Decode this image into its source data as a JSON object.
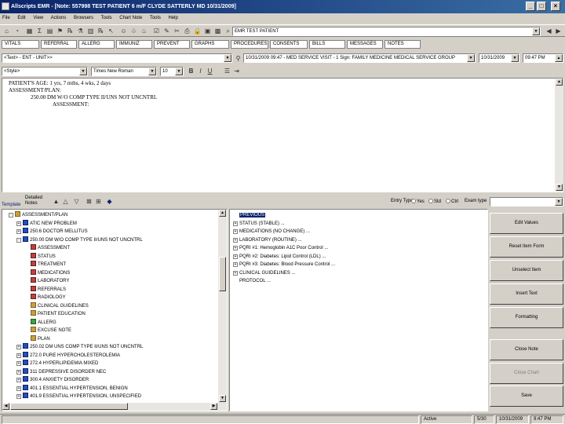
{
  "window": {
    "title": "Allscripts EMR - [Note: 557998 TEST PATIENT 6 m/F CLYDE SATTERLY MD 10/31/2009]",
    "minimize": "_",
    "maximize": "□",
    "close": "×"
  },
  "menu": [
    "File",
    "Edit",
    "View",
    "Actions",
    "Browsers",
    "Tools",
    "Chart Note",
    "Tools",
    "Help"
  ],
  "toolbar": {
    "patient_combo": "EMR TEST PATIENT"
  },
  "tabs": [
    "VITALS",
    "REFERRAL",
    "ALLERG",
    "IMMUNIZ",
    "PREVENT",
    "GRAPHS",
    "PROCEDURES",
    "CONSENTS",
    "BILLS",
    "MESSAGES",
    "NOTES"
  ],
  "note_row": {
    "template_combo": "<Text> - ENT - UNIT>>",
    "info_combo": "10/31/2009 09:47 - MED SERVICE VISIT - 1 Sign: FAMILY MEDICINE MEDICAL SERVICE GROUP",
    "date_value": "10/31/2009",
    "time_value": "09:47 PM"
  },
  "format_row": {
    "style_value": "<Style>",
    "font_value": "Times New Roman",
    "size_value": "10"
  },
  "editor": {
    "line1": "PATIENT'S AGE: 1 yrs, 7 mths, 4 wks, 2 days",
    "line2": "ASSESSMENT/PLAN:",
    "line3": "250.00 DM W/O COMP TYPE II/UNS NOT UNCNTRL",
    "line4": "ASSESSMENT:"
  },
  "lower_bar": {
    "template_label": "Template",
    "tab_label": "Detailed Notes",
    "entry_type_label": "Entry Type",
    "radio_1": "Yes",
    "radio_2": "Std",
    "radio_3": "Ctrl",
    "exam_label": "Exam type"
  },
  "tree": [
    {
      "text": "ASSESSMENT/PLAN",
      "indent": 0,
      "exp": "-",
      "icon": "folder",
      "sel": false
    },
    {
      "text": "ATIC NEW PROBLEM",
      "indent": 1,
      "exp": "+",
      "icon": "blue",
      "sel": false
    },
    {
      "text": "250.6 DOCTOR MELLITUS",
      "indent": 1,
      "exp": "+",
      "icon": "blue",
      "sel": false
    },
    {
      "text": "250.00 DM W/O COMP TYPE II/UNS NOT UNCNTRL",
      "indent": 1,
      "exp": "-",
      "icon": "blue",
      "sel": false
    },
    {
      "text": "ASSESSMENT",
      "indent": 2,
      "exp": "",
      "icon": "red",
      "sel": false
    },
    {
      "text": "STATUS",
      "indent": 2,
      "exp": "",
      "icon": "red",
      "sel": false
    },
    {
      "text": "TREATMENT",
      "indent": 2,
      "exp": "",
      "icon": "red",
      "sel": false
    },
    {
      "text": "MEDICATIONS",
      "indent": 2,
      "exp": "",
      "icon": "red",
      "sel": false
    },
    {
      "text": "LABORATORY",
      "indent": 2,
      "exp": "",
      "icon": "red",
      "sel": false
    },
    {
      "text": "REFERRALS",
      "indent": 2,
      "exp": "",
      "icon": "red",
      "sel": false
    },
    {
      "text": "RADIOLOGY",
      "indent": 2,
      "exp": "",
      "icon": "red",
      "sel": false
    },
    {
      "text": "CLINICAL GUIDELINES",
      "indent": 2,
      "exp": "",
      "icon": "folder",
      "sel": false
    },
    {
      "text": "PATIENT EDUCATION",
      "indent": 2,
      "exp": "",
      "icon": "folder",
      "sel": false
    },
    {
      "text": "ALLERG",
      "indent": 2,
      "exp": "",
      "icon": "grn",
      "sel": false
    },
    {
      "text": "EXCUSE NOTE",
      "indent": 2,
      "exp": "",
      "icon": "folder",
      "sel": false
    },
    {
      "text": "PLAN",
      "indent": 2,
      "exp": "",
      "icon": "folder",
      "sel": false
    },
    {
      "text": "250.02 DM UNS COMP TYPE II/UNS NOT UNCNTRL",
      "indent": 1,
      "exp": "+",
      "icon": "blue",
      "sel": false
    },
    {
      "text": "272.0 PURE HYPERCHOLESTEROLEMIA",
      "indent": 1,
      "exp": "+",
      "icon": "blue",
      "sel": false
    },
    {
      "text": "272.4 HYPERLIPIDEMIA MIXED",
      "indent": 1,
      "exp": "+",
      "icon": "blue",
      "sel": false
    },
    {
      "text": "311 DEPRESSIVE DISORDER NEC",
      "indent": 1,
      "exp": "+",
      "icon": "blue",
      "sel": false
    },
    {
      "text": "300.4 ANXIETY DISORDER",
      "indent": 1,
      "exp": "+",
      "icon": "blue",
      "sel": false
    },
    {
      "text": "401.1 ESSENTIAL HYPERTENSION, BENIGN",
      "indent": 1,
      "exp": "+",
      "icon": "blue",
      "sel": false
    },
    {
      "text": "401.9 ESSENTIAL HYPERTENSION, UNSPECIFIED",
      "indent": 1,
      "exp": "+",
      "icon": "blue",
      "sel": false
    }
  ],
  "list": [
    {
      "text": "PREVIOUS",
      "exp": "",
      "sel": true
    },
    {
      "text": "STATUS (STABLE) ...",
      "exp": "+",
      "sel": false
    },
    {
      "text": "MEDICATIONS (NO CHANGE) ...",
      "exp": "+",
      "sel": false
    },
    {
      "text": "LABORATORY (ROUTINE) ...",
      "exp": "+",
      "sel": false
    },
    {
      "text": "PQRI #1: Hemoglobin A1C Poor Control ...",
      "exp": "+",
      "sel": false
    },
    {
      "text": "PQRI #2: Diabetes: Lipid Control (LDL) ...",
      "exp": "+",
      "sel": false
    },
    {
      "text": "PQRI #3: Diabetes: Blood Pressure Control ...",
      "exp": "+",
      "sel": false
    },
    {
      "text": "CLINICAL GUIDELINES ...",
      "exp": "+",
      "sel": false
    },
    {
      "text": "PROTOCOL ...",
      "exp": "",
      "sel": false
    }
  ],
  "buttons": [
    {
      "label": "Edit Values",
      "disabled": false
    },
    {
      "label": "Reset Item Form",
      "disabled": false
    },
    {
      "label": "Unselect Item",
      "disabled": false
    },
    {
      "label": "Insert Text",
      "disabled": false
    },
    {
      "label": "Formatting",
      "disabled": false
    },
    {
      "label": "Close Note",
      "disabled": false
    },
    {
      "label": "Close Chart",
      "disabled": true
    },
    {
      "label": "Save",
      "disabled": false
    }
  ],
  "status": {
    "cell1": "Active",
    "cell2": "5/30",
    "cell3": "10/31/2009",
    "cell4": "9:47 PM"
  }
}
